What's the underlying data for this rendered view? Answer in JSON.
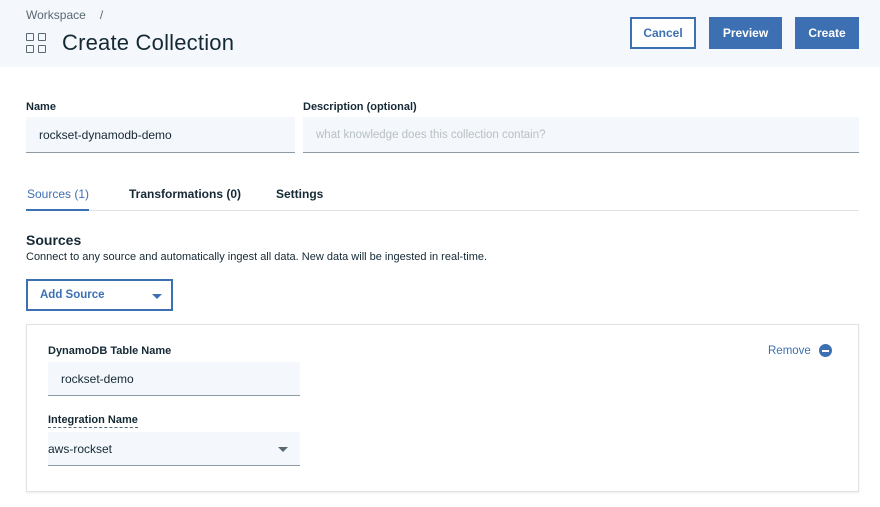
{
  "header": {
    "breadcrumb": {
      "item": "Workspace",
      "separator": "/"
    },
    "title": "Create Collection",
    "icon": "grid-icon",
    "buttons": {
      "cancel": "Cancel",
      "preview": "Preview",
      "create": "Create"
    }
  },
  "form": {
    "name_label": "Name",
    "name_value": "rockset-dynamodb-demo",
    "description_label": "Description (optional)",
    "description_placeholder": "what knowledge does this collection contain?"
  },
  "tabs": [
    {
      "label": "Sources (1)",
      "active": true
    },
    {
      "label": "Transformations (0)",
      "active": false
    },
    {
      "label": "Settings",
      "active": false
    }
  ],
  "sources": {
    "title": "Sources",
    "description": "Connect to any source and automatically ingest all data. New data will be ingested in real-time.",
    "add_source_label": "Add Source",
    "card": {
      "table_name_label": "DynamoDB Table Name",
      "table_name_value": "rockset-demo",
      "integration_label": "Integration Name",
      "integration_value": "aws-rockset",
      "remove_label": "Remove"
    }
  },
  "colors": {
    "accent": "#3d70b2",
    "header_bg": "#f4f7fb",
    "text": "#152935"
  }
}
